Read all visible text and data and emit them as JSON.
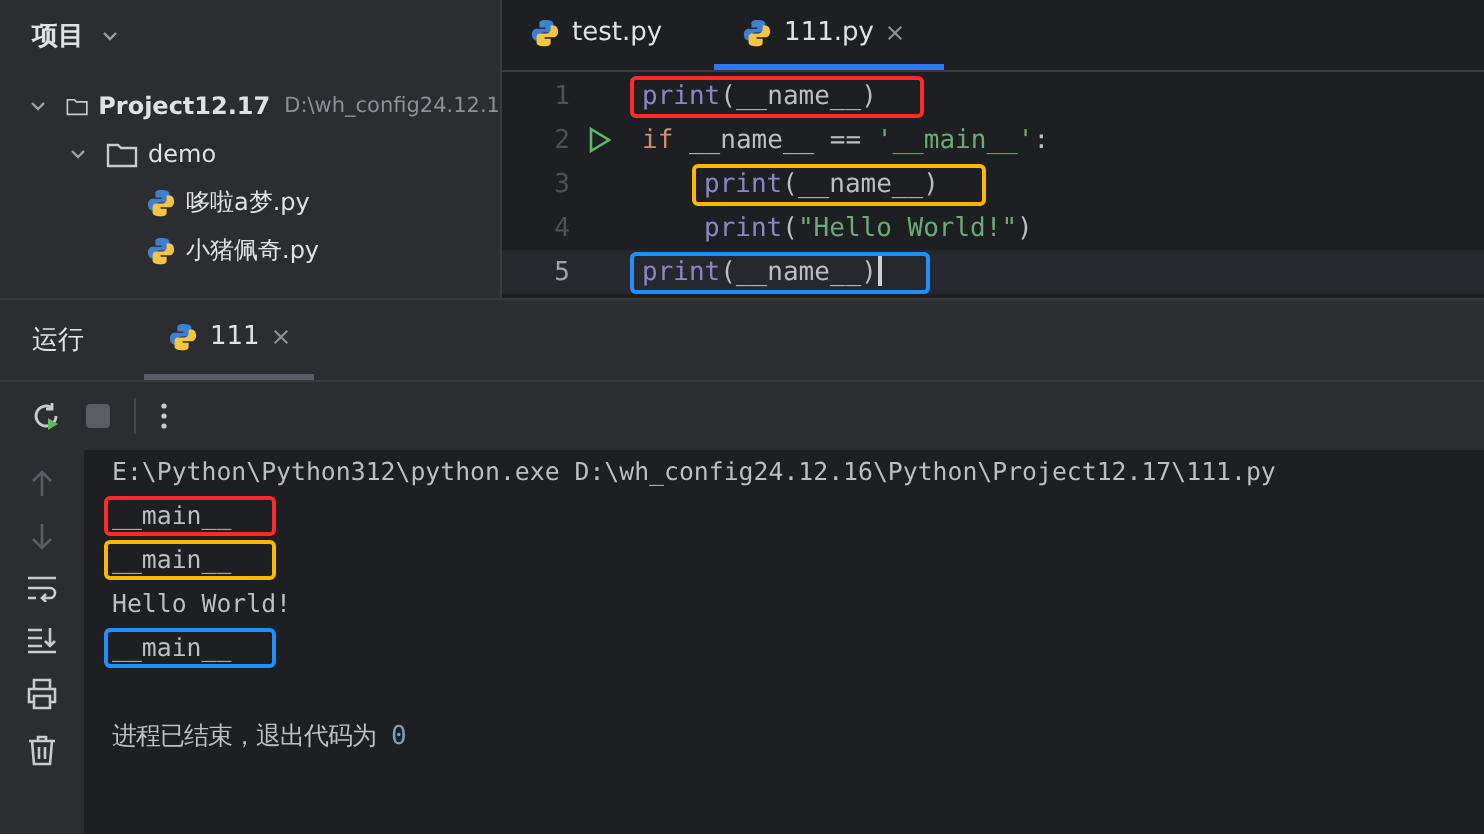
{
  "project_panel": {
    "title": "项目",
    "tree": [
      {
        "label": "Project12.17",
        "path": "D:\\wh_config24.12.1",
        "kind": "folder",
        "expanded": true,
        "children": [
          {
            "label": "demo",
            "kind": "folder",
            "expanded": true,
            "children": [
              {
                "label": "哆啦a梦.py",
                "kind": "python"
              },
              {
                "label": "小猪佩奇.py",
                "kind": "python"
              }
            ]
          }
        ]
      }
    ]
  },
  "editor": {
    "tabs": [
      {
        "label": "test.py",
        "selected": false
      },
      {
        "label": "111.py",
        "selected": true
      }
    ],
    "lines": [
      {
        "number": "1",
        "runnable": false,
        "current": false,
        "indented": false,
        "color": "#ff2a2a",
        "tokens": [
          {
            "kind": "builtin",
            "text": "print"
          },
          {
            "kind": "plain",
            "text": "(__name__)"
          }
        ]
      },
      {
        "number": "2",
        "runnable": true,
        "current": false,
        "indented": false,
        "tokens": [
          {
            "kind": "keyword",
            "text": "if"
          },
          {
            "kind": "plain",
            "text": " __name__ == "
          },
          {
            "kind": "string",
            "text": "'__main__'"
          },
          {
            "kind": "plain",
            "text": ":"
          }
        ]
      },
      {
        "number": "3",
        "runnable": false,
        "current": false,
        "indented": true,
        "color": "#ffb700",
        "tokens": [
          {
            "kind": "builtin",
            "text": "print"
          },
          {
            "kind": "plain",
            "text": "(__name__)"
          }
        ]
      },
      {
        "number": "4",
        "runnable": false,
        "current": false,
        "indented": true,
        "tokens": [
          {
            "kind": "builtin",
            "text": "print"
          },
          {
            "kind": "plain",
            "text": "("
          },
          {
            "kind": "string",
            "text": "\"Hello World!\""
          },
          {
            "kind": "plain",
            "text": ")"
          }
        ]
      },
      {
        "number": "5",
        "runnable": false,
        "current": true,
        "indented": false,
        "color": "#1e90ff",
        "tokens": [
          {
            "kind": "builtin",
            "text": "print"
          },
          {
            "kind": "plain",
            "text": "(__name__)"
          }
        ]
      }
    ]
  },
  "run_panel": {
    "title": "运行",
    "tabs": [
      {
        "label": "111",
        "selected": true
      }
    ],
    "output": [
      {
        "kind": "command",
        "text": "E:\\Python\\Python312\\python.exe D:\\wh_config24.12.16\\Python\\Project12.17\\111.py"
      },
      {
        "kind": "stdout",
        "text": "__main__",
        "color": "#ff2a2a"
      },
      {
        "kind": "stdout",
        "text": "__main__",
        "color": "#ffb700"
      },
      {
        "kind": "stdout",
        "text": "Hello World!"
      },
      {
        "kind": "stdout",
        "text": "__main__",
        "color": "#1e90ff"
      },
      {
        "kind": "exit",
        "text": "进程已结束，退出代码为 ",
        "code": "0"
      }
    ]
  }
}
